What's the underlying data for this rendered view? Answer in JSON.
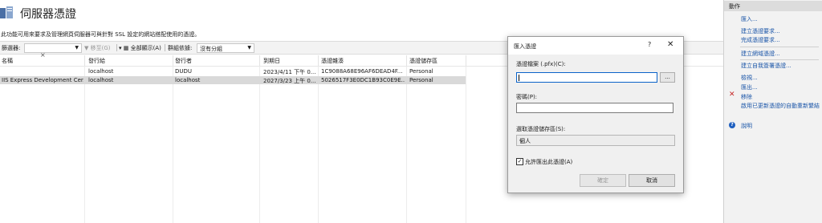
{
  "page": {
    "title": "伺服器憑證",
    "description": "此功能可用來要求及管理網頁伺服器可與針對 SSL 設定的網站搭配使用的憑證。"
  },
  "toolbar": {
    "filter_label": "篩選器:",
    "go_label": "移至(G)",
    "show_all_label": "全部顯示(A)",
    "group_label": "群組依據:",
    "group_value": "沒有分組"
  },
  "table": {
    "columns": [
      "名稱",
      "發行給",
      "發行者",
      "到期日",
      "憑證雜湊",
      "憑證儲存區"
    ],
    "rows": [
      {
        "name": "",
        "issued_to": "localhost",
        "issuer": "DUDU",
        "expiry": "2023/4/11 下午 0...",
        "hash": "1C9088A68E96AF6DEAD4F...",
        "store": "Personal",
        "selected": false
      },
      {
        "name": "IIS Express Development Cer...",
        "issued_to": "localhost",
        "issuer": "localhost",
        "expiry": "2027/3/23 上午 0...",
        "hash": "5026517F3E0DC1B93C0E9E...",
        "store": "Personal",
        "selected": true
      }
    ]
  },
  "actions": {
    "header": "動作",
    "import": "匯入...",
    "create_request": "建立憑證要求...",
    "complete_request": "完成憑證要求...",
    "create_domain": "建立網域憑證...",
    "create_self_signed": "建立自我簽署憑證...",
    "view": "檢視...",
    "export": "匯出...",
    "remove": "移除",
    "enable_auto_rebind": "啟用已更新憑證的自動重新繫結",
    "help": "說明"
  },
  "dialog": {
    "title": "匯入憑證",
    "help_glyph": "?",
    "file_label": "憑證檔案 (.pfx)(C):",
    "file_value": "",
    "browse_label": "...",
    "password_label": "密碼(P):",
    "password_value": "",
    "store_label": "選取憑證儲存區(S):",
    "store_value": "個人",
    "allow_export_label": "允許匯出此憑證(A)",
    "allow_export_checked": true,
    "ok_label": "確定",
    "cancel_label": "取消"
  }
}
